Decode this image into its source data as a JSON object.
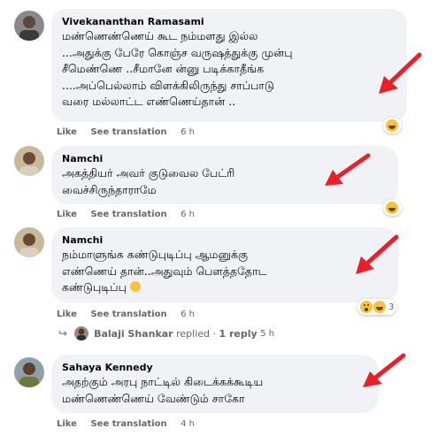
{
  "colors": {
    "arrow": "#e8202a",
    "bubble": "#f0f2f5",
    "meta": "#65676b"
  },
  "comments": [
    {
      "author": "Vivekananthan Ramasami",
      "lines": [
        "மண்ணெண்ணெய் கூட நம்மளது இல்ல",
        "...அதுக்கு பேரே கொஞ்ச வருஷத்துக்கு முன்பு",
        "சீமெண்ணெ ..சீமானே ன்னு படிக்காதீங்க",
        "....அப்பெல்லாம் விளக்கிலிருந்து சாப்பாடு",
        "வரை மல்லாட்ட எண்ணெய்தான் .."
      ],
      "like": "Like",
      "translate": "See translation",
      "time": "6 h",
      "reaction_icon": "haha-icon"
    },
    {
      "author": "Namchi",
      "lines": [
        "அகத்தியர் அவர் குடுவைல பேட்ரி",
        "வைச்சிருந்தாராமே"
      ],
      "like": "Like",
      "translate": "See translation",
      "time": "6 h",
      "reaction_icon": "haha-icon"
    },
    {
      "author": "Namchi",
      "lines": [
        "நம்மாளுங்க கண்டுபுடிப்பு ஆமனுக்கு",
        "எண்ணெய் தான்..அதுவும் பௌத்ததோட",
        "கண்டுபுடிப்பு"
      ],
      "like": "Like",
      "translate": "See translation",
      "time": "6 h",
      "reaction_count": "3"
    },
    {
      "author": "Sahaya Kennedy",
      "lines": [
        "அதற்கும் அரபு நாட்டில் கிடைக்கக்கூடிய",
        "மண்ணெண்ணெய் வேண்டும் சாகோ"
      ],
      "like": "Like",
      "translate": "See translation",
      "time": "4 h"
    }
  ],
  "reply": {
    "name": "Balaji Shankar",
    "action": "replied",
    "sep": "·",
    "count": "1 reply",
    "time": "5 h"
  }
}
